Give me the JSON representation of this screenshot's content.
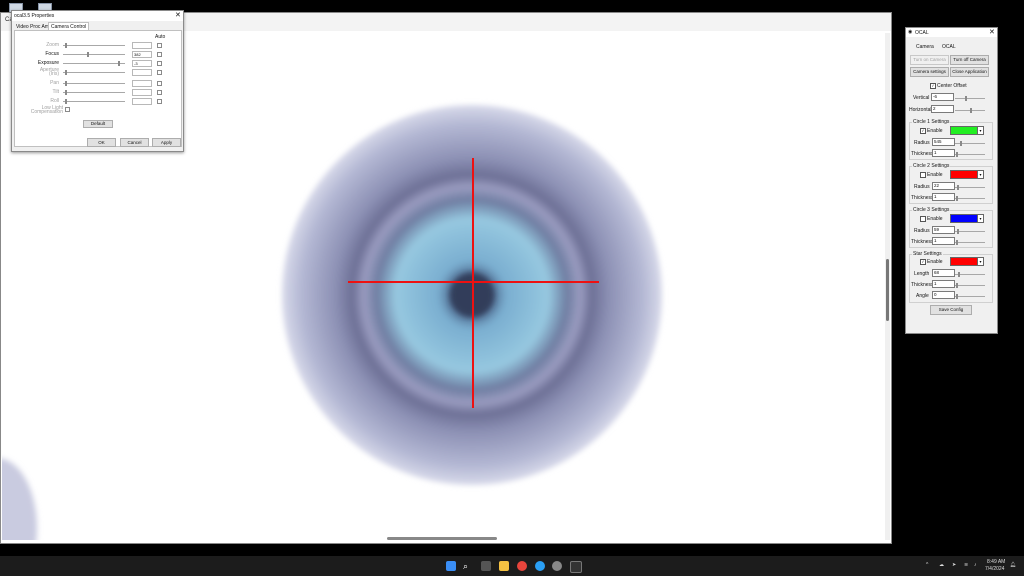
{
  "viewer": {
    "title": "Cam"
  },
  "props": {
    "title": "ocal3.5 Properties",
    "tabs": [
      "Video Proc Amp",
      "Camera Control"
    ],
    "auto_label": "Auto",
    "rows": [
      {
        "label": "Zoom",
        "value": "",
        "enabled": false
      },
      {
        "label": "Focus",
        "value": "382",
        "enabled": true
      },
      {
        "label": "Exposure",
        "value": "-3",
        "enabled": true
      },
      {
        "label": "Aperture (Iris)",
        "value": "",
        "enabled": false
      },
      {
        "label": "Pan",
        "value": "",
        "enabled": false
      },
      {
        "label": "Tilt",
        "value": "",
        "enabled": false
      },
      {
        "label": "Roll",
        "value": "",
        "enabled": false
      }
    ],
    "low_light": "Low Light Compensation",
    "default_label": "Default",
    "ok_label": "OK",
    "cancel_label": "Cancel",
    "apply_label": "Apply"
  },
  "ocal": {
    "title": "OCAL",
    "menu": [
      "Camera",
      "OCAL"
    ],
    "turn_on": "Turn on Camera",
    "turn_off": "Turn off Camera",
    "camera_settings": "Camera settings",
    "close_app": "Close Application",
    "center_offset": "Center Offset",
    "vertical_label": "Vertical",
    "vertical": "-6",
    "horizontal_label": "Horizontal",
    "horizontal": "2",
    "circle1": {
      "title": "Circle 1 Settings",
      "enable": "Enable",
      "radius_label": "Radius",
      "radius": "545",
      "thickness_label": "Thickness",
      "thickness": "1",
      "color": "#22ee22",
      "checked": true
    },
    "circle2": {
      "title": "Circle 2 Settings",
      "enable": "Enable",
      "radius_label": "Radius",
      "radius": "22",
      "thickness_label": "Thickness",
      "thickness": "1",
      "color": "#ff0000",
      "checked": false
    },
    "circle3": {
      "title": "Circle 3 Settings",
      "enable": "Enable",
      "radius_label": "Radius",
      "radius": "59",
      "thickness_label": "Thickness",
      "thickness": "1",
      "color": "#0000ff",
      "checked": false
    },
    "star": {
      "title": "Star Settings",
      "enable": "Enable",
      "length_label": "Length",
      "length": "68",
      "thickness_label": "Thickness",
      "thickness": "1",
      "angle_label": "Angle",
      "angle": "0",
      "color": "#ff0000",
      "checked": true
    },
    "save_label": "Save Config"
  },
  "overlay": {
    "crosshair_color": "#ee1111"
  },
  "taskbar": {
    "time": "8:49 AM",
    "date": "7/4/2024"
  }
}
